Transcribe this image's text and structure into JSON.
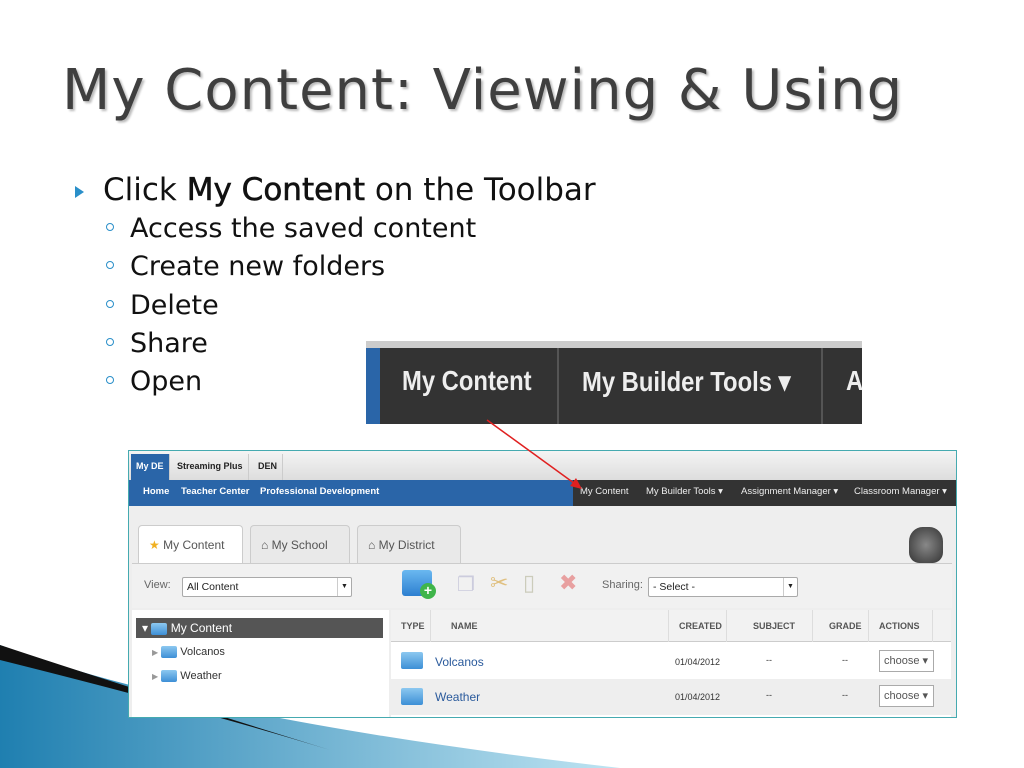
{
  "slide": {
    "title": "My Content: Viewing & Using",
    "bullet_pre": "Click ",
    "bullet_bold": "My Content",
    "bullet_post": " on the Toolbar",
    "subbullets": [
      "Access the saved content",
      "Create new folders",
      "Delete",
      "Share",
      "Open"
    ]
  },
  "zoomed_toolbar": {
    "items": [
      "My Content",
      "My Builder Tools ▾",
      "A"
    ]
  },
  "screenshot": {
    "top_tabs": [
      "My DE",
      "Streaming Plus",
      "DEN"
    ],
    "nav_left": [
      "Home",
      "Teacher Center",
      "Professional Development"
    ],
    "nav_right": [
      "My Content",
      "My Builder Tools ▾",
      "Assignment Manager ▾",
      "Classroom Manager ▾"
    ],
    "content_tabs": [
      "My Content",
      "My School",
      "My District"
    ],
    "view_label": "View:",
    "view_value": "All Content",
    "sharing_label": "Sharing:",
    "sharing_value": "- Select -",
    "tree": {
      "root": "My Content",
      "children": [
        "Volcanos",
        "Weather"
      ]
    },
    "columns": [
      "TYPE",
      "NAME",
      "CREATED",
      "SUBJECT",
      "GRADE",
      "ACTIONS"
    ],
    "rows": [
      {
        "name": "Volcanos",
        "created": "01/04/2012",
        "subject": "--",
        "grade": "--",
        "action": "choose ▾"
      },
      {
        "name": "Weather",
        "created": "01/04/2012",
        "subject": "--",
        "grade": "--",
        "action": "choose ▾"
      }
    ]
  },
  "colors": {
    "accent": "#2a8fc9",
    "nav_blue": "#2a65a8",
    "arrow": "#e02020"
  }
}
